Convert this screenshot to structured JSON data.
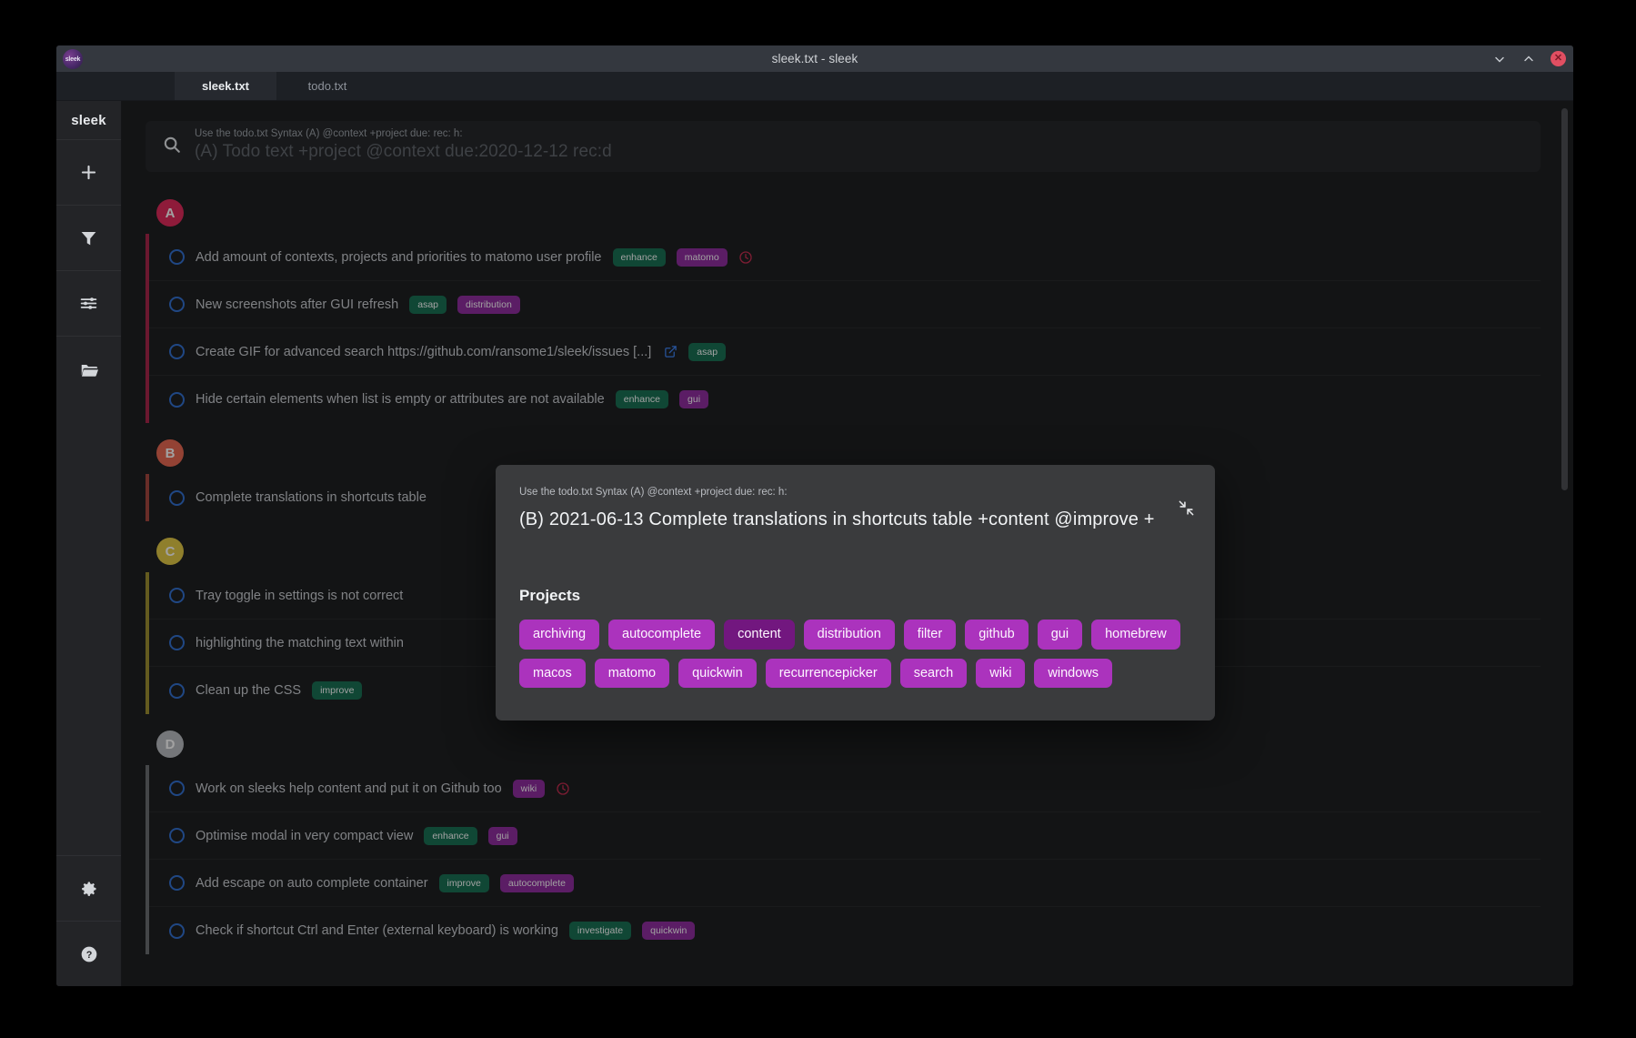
{
  "window": {
    "title": "sleek.txt - sleek",
    "logo_text": "sleek",
    "controls": {
      "minimize_icon": "chevron-down-icon",
      "maximize_icon": "chevron-up-icon",
      "close_icon": "close-icon",
      "close_glyph": "✕"
    }
  },
  "tabs": [
    {
      "label": "sleek.txt",
      "active": true
    },
    {
      "label": "todo.txt",
      "active": false
    }
  ],
  "sidebar": {
    "brand": "sleek",
    "items": [
      {
        "name": "add-todo-button",
        "icon": "plus-icon"
      },
      {
        "name": "filter-button",
        "icon": "funnel-icon"
      },
      {
        "name": "settings-sliders-button",
        "icon": "sliders-icon"
      },
      {
        "name": "open-file-button",
        "icon": "folder-open-icon"
      }
    ],
    "bottom_items": [
      {
        "name": "settings-button",
        "icon": "gear-icon"
      },
      {
        "name": "help-button",
        "icon": "help-circle-icon"
      }
    ]
  },
  "search": {
    "icon": "search-icon",
    "hint": "Use the todo.txt Syntax (A) @context +project due: rec: h:",
    "placeholder": "(A) Todo text +project @context due:2020-12-12 rec:d"
  },
  "colors": {
    "priority_a": "#e0285a",
    "priority_b": "#e8674f",
    "priority_c": "#e3c843",
    "priority_d": "#b9bcc0",
    "context_tag": "#156e52",
    "project_tag": "#8e2a9e",
    "chip": "#ab33bd",
    "chip_used": "#72177f",
    "recurrence": "#c62b4e",
    "checkbox": "#2f6fd0",
    "link": "#3b82f6"
  },
  "groups": [
    {
      "priority": "A",
      "badge_color": "#e0285a",
      "bar_color": "#a92348",
      "todos": [
        {
          "text": "Add amount of contexts, projects and priorities to matomo user profile",
          "tags": [
            {
              "label": "enhance",
              "type": "ctx"
            },
            {
              "label": "matomo",
              "type": "proj"
            }
          ],
          "recurrence": true,
          "link": false
        },
        {
          "text": "New screenshots after GUI refresh",
          "tags": [
            {
              "label": "asap",
              "type": "ctx"
            },
            {
              "label": "distribution",
              "type": "proj"
            }
          ],
          "recurrence": false,
          "link": false
        },
        {
          "text": "Create GIF for advanced search https://github.com/ransome1/sleek/issues [...]",
          "tags": [
            {
              "label": "asap",
              "type": "ctx"
            }
          ],
          "recurrence": false,
          "link": true
        },
        {
          "text": "Hide certain elements when list is empty or attributes are not available",
          "tags": [
            {
              "label": "enhance",
              "type": "ctx"
            },
            {
              "label": "gui",
              "type": "proj"
            }
          ],
          "recurrence": false,
          "link": false
        }
      ]
    },
    {
      "priority": "B",
      "badge_color": "#e8674f",
      "bar_color": "#a5443c",
      "todos": [
        {
          "text": "Complete translations in shortcuts table",
          "tags": [],
          "recurrence": false,
          "link": false
        }
      ]
    },
    {
      "priority": "C",
      "badge_color": "#e3c843",
      "bar_color": "#9d8f2e",
      "todos": [
        {
          "text": "Tray toggle in settings is not correct",
          "tags": [],
          "recurrence": false,
          "link": false
        },
        {
          "text": "highlighting the matching text within",
          "tags": [],
          "recurrence": false,
          "link": false
        },
        {
          "text": "Clean up the CSS",
          "tags": [
            {
              "label": "improve",
              "type": "ctx"
            }
          ],
          "recurrence": false,
          "link": false
        }
      ]
    },
    {
      "priority": "D",
      "badge_color": "#b9bcc0",
      "bar_color": "#6a6c70",
      "todos": [
        {
          "text": "Work on sleeks help content and put it on Github too",
          "tags": [
            {
              "label": "wiki",
              "type": "proj"
            }
          ],
          "recurrence": true,
          "link": false
        },
        {
          "text": "Optimise modal in very compact view",
          "tags": [
            {
              "label": "enhance",
              "type": "ctx"
            },
            {
              "label": "gui",
              "type": "proj"
            }
          ],
          "recurrence": false,
          "link": false
        },
        {
          "text": "Add escape on auto complete container",
          "tags": [
            {
              "label": "improve",
              "type": "ctx"
            },
            {
              "label": "autocomplete",
              "type": "proj"
            }
          ],
          "recurrence": false,
          "link": false
        },
        {
          "text": "Check if shortcut Ctrl and Enter (external keyboard) is working",
          "tags": [
            {
              "label": "investigate",
              "type": "ctx"
            },
            {
              "label": "quickwin",
              "type": "proj"
            }
          ],
          "recurrence": false,
          "link": false
        }
      ]
    }
  ],
  "modal": {
    "hint": "Use the todo.txt Syntax (A) @context +project due: rec: h:",
    "input_value": "(B) 2021-06-13 Complete translations in shortcuts table +content @improve +",
    "collapse_icon": "compress-arrows-icon",
    "section_title": "Projects",
    "chips": [
      {
        "label": "archiving",
        "used": false
      },
      {
        "label": "autocomplete",
        "used": false
      },
      {
        "label": "content",
        "used": true
      },
      {
        "label": "distribution",
        "used": false
      },
      {
        "label": "filter",
        "used": false
      },
      {
        "label": "github",
        "used": false
      },
      {
        "label": "gui",
        "used": false
      },
      {
        "label": "homebrew",
        "used": false
      },
      {
        "label": "macos",
        "used": false
      },
      {
        "label": "matomo",
        "used": false
      },
      {
        "label": "quickwin",
        "used": false
      },
      {
        "label": "recurrencepicker",
        "used": false
      },
      {
        "label": "search",
        "used": false
      },
      {
        "label": "wiki",
        "used": false
      },
      {
        "label": "windows",
        "used": false
      }
    ]
  }
}
